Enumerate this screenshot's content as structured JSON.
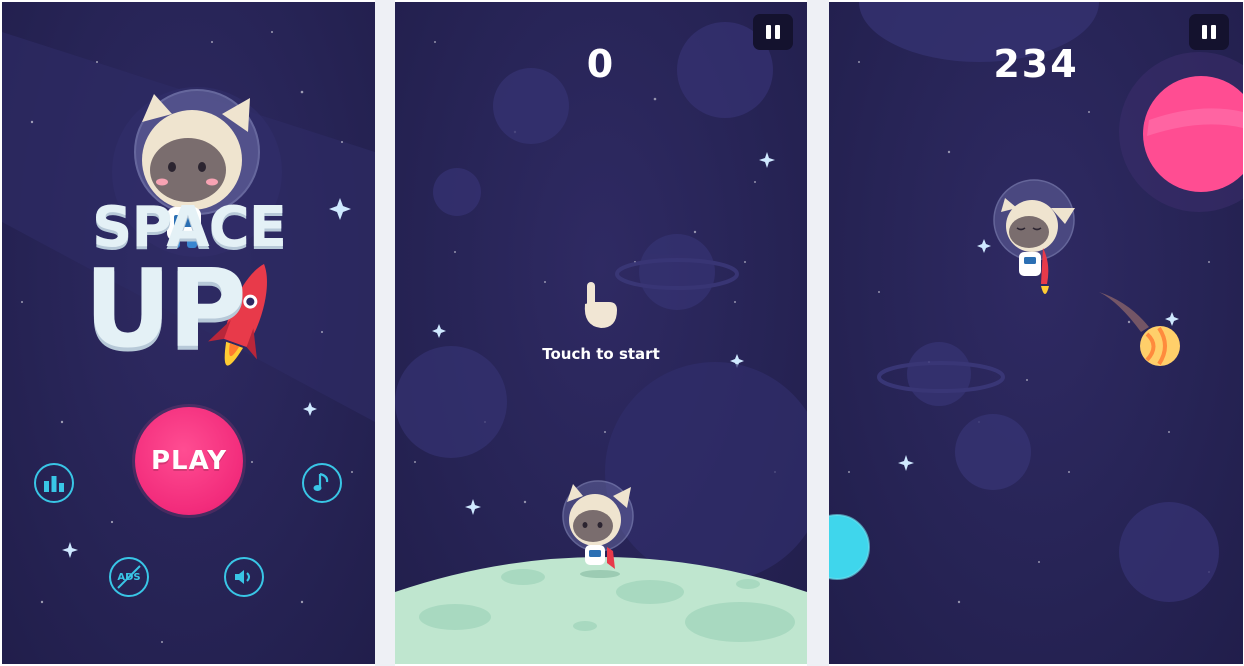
{
  "colors": {
    "background": "#272456",
    "play_button": "#f22b7b",
    "icon_accent": "#39c6e6",
    "moon_surface": "#bfe6cf",
    "pink_planet": "#ff4d92",
    "cyan_planet": "#3fd6ec",
    "text": "#ffffff"
  },
  "menu": {
    "logo_line1": "SPACE",
    "logo_line2": "UP",
    "play_label": "PLAY",
    "leaderboard_icon": "bar-chart-icon",
    "music_icon": "music-note-icon",
    "no_ads_label": "ADS",
    "sound_icon": "speaker-icon"
  },
  "start_screen": {
    "score": "0",
    "hint": "Touch to start",
    "hint_icon": "pointing-hand-icon",
    "pause_icon": "pause-icon"
  },
  "gameplay": {
    "score": "234",
    "pause_icon": "pause-icon"
  }
}
